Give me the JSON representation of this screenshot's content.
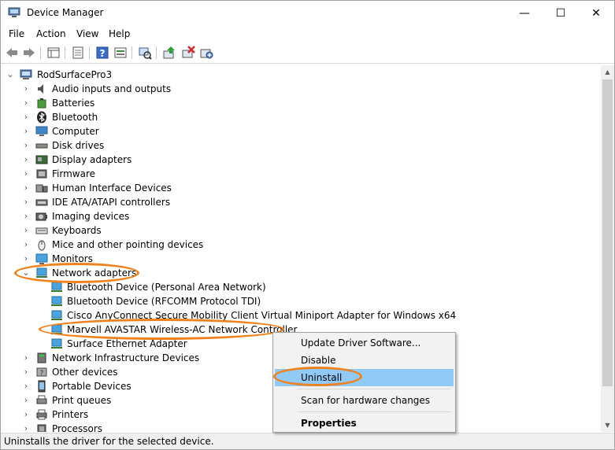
{
  "window": {
    "title": "Device Manager",
    "minimize_glyph": "—",
    "maximize_glyph": "☐",
    "close_glyph": "✕"
  },
  "menu": {
    "items": [
      {
        "label": "File"
      },
      {
        "label": "Action"
      },
      {
        "label": "View"
      },
      {
        "label": "Help"
      }
    ]
  },
  "toolbar": {
    "buttons": [
      "back-icon",
      "forward-icon",
      "properties-grid-icon",
      "show-hidden-icon",
      "help-icon",
      "device-view-icon",
      "scan-hardware-icon",
      "update-driver-icon",
      "uninstall-icon",
      "add-legacy-icon"
    ]
  },
  "tree": {
    "root": "RodSurfacePro3",
    "categories": [
      {
        "label": "Audio inputs and outputs",
        "icon": "speaker-icon"
      },
      {
        "label": "Batteries",
        "icon": "battery-icon"
      },
      {
        "label": "Bluetooth",
        "icon": "bluetooth-icon"
      },
      {
        "label": "Computer",
        "icon": "computer-icon"
      },
      {
        "label": "Disk drives",
        "icon": "disk-icon"
      },
      {
        "label": "Display adapters",
        "icon": "display-adapter-icon"
      },
      {
        "label": "Firmware",
        "icon": "firmware-icon"
      },
      {
        "label": "Human Interface Devices",
        "icon": "hid-icon"
      },
      {
        "label": "IDE ATA/ATAPI controllers",
        "icon": "ide-icon"
      },
      {
        "label": "Imaging devices",
        "icon": "camera-icon"
      },
      {
        "label": "Keyboards",
        "icon": "keyboard-icon"
      },
      {
        "label": "Mice and other pointing devices",
        "icon": "mouse-icon"
      },
      {
        "label": "Monitors",
        "icon": "monitor-icon"
      },
      {
        "label": "Network adapters",
        "icon": "network-icon"
      }
    ],
    "network_children": [
      {
        "label": "Bluetooth Device (Personal Area Network)"
      },
      {
        "label": "Bluetooth Device (RFCOMM Protocol TDI)"
      },
      {
        "label": "Cisco AnyConnect Secure Mobility Client Virtual Miniport Adapter for Windows x64"
      },
      {
        "label": "Marvell AVASTAR Wireless-AC Network Controller"
      },
      {
        "label": "Surface Ethernet Adapter"
      }
    ],
    "categories_after": [
      {
        "label": "Network Infrastructure Devices",
        "icon": "network-infra-icon"
      },
      {
        "label": "Other devices",
        "icon": "other-devices-icon"
      },
      {
        "label": "Portable Devices",
        "icon": "portable-device-icon"
      },
      {
        "label": "Print queues",
        "icon": "print-queue-icon"
      },
      {
        "label": "Printers",
        "icon": "printer-icon"
      },
      {
        "label": "Processors",
        "icon": "processor-icon"
      }
    ],
    "expander_collapsed": "›",
    "expander_expanded": "⌄"
  },
  "context_menu": {
    "update": "Update Driver Software...",
    "disable": "Disable",
    "uninstall": "Uninstall",
    "scan": "Scan for hardware changes",
    "properties": "Properties"
  },
  "status": {
    "text": "Uninstalls the driver for the selected device."
  },
  "colors": {
    "highlight_oval": "#f0821e",
    "menu_hover": "#91c9f7"
  }
}
